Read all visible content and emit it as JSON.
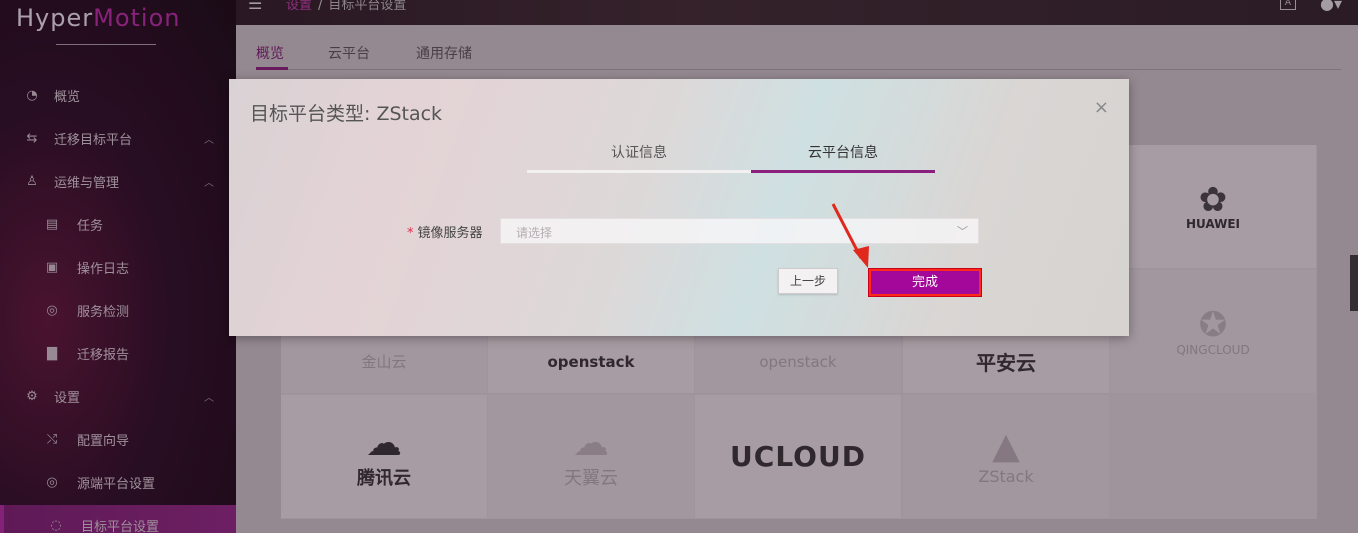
{
  "app": {
    "logo_part1": "Hyper",
    "logo_part2": "Motion",
    "brand_color": "#8a1f7d"
  },
  "topbar": {
    "breadcrumb_1": "设置",
    "breadcrumb_sep": "/",
    "breadcrumb_2": "目标平台设置",
    "lang_icon_text": "A"
  },
  "sidebar": {
    "items": [
      {
        "label": "概览",
        "icon": "dashboard-icon"
      },
      {
        "label": "迁移目标平台",
        "icon": "swap-icon"
      },
      {
        "label": "运维与管理",
        "icon": "user-icon"
      },
      {
        "label": "任务",
        "icon": "task-icon"
      },
      {
        "label": "操作日志",
        "icon": "log-icon"
      },
      {
        "label": "服务检测",
        "icon": "search-icon"
      },
      {
        "label": "迁移报告",
        "icon": "report-icon"
      },
      {
        "label": "设置",
        "icon": "gear-icon"
      },
      {
        "label": "配置向导",
        "icon": "shuffle-icon"
      },
      {
        "label": "源端平台设置",
        "icon": "target-icon"
      },
      {
        "label": "目标平台设置",
        "icon": "target-icon"
      }
    ]
  },
  "main": {
    "tabs": [
      "概览",
      "云平台",
      "通用存储"
    ],
    "tiles": [
      {
        "name": "HUAWEI"
      },
      {
        "name": "金山云"
      },
      {
        "name": "openstack"
      },
      {
        "name": "openstack"
      },
      {
        "name": "平安云"
      },
      {
        "name": "QINGCLOUD"
      },
      {
        "name": "腾讯云"
      },
      {
        "name": "天翼云"
      },
      {
        "name": "UCLOUD"
      },
      {
        "name": "ZStack"
      }
    ]
  },
  "dialog": {
    "title": "目标平台类型: ZStack",
    "close_glyph": "×",
    "steps": [
      "认证信息",
      "云平台信息"
    ],
    "field_required_mark": "*",
    "field_label": "镜像服务器",
    "select_placeholder": "请选择",
    "prev_button": "上一步",
    "done_button": "完成"
  }
}
